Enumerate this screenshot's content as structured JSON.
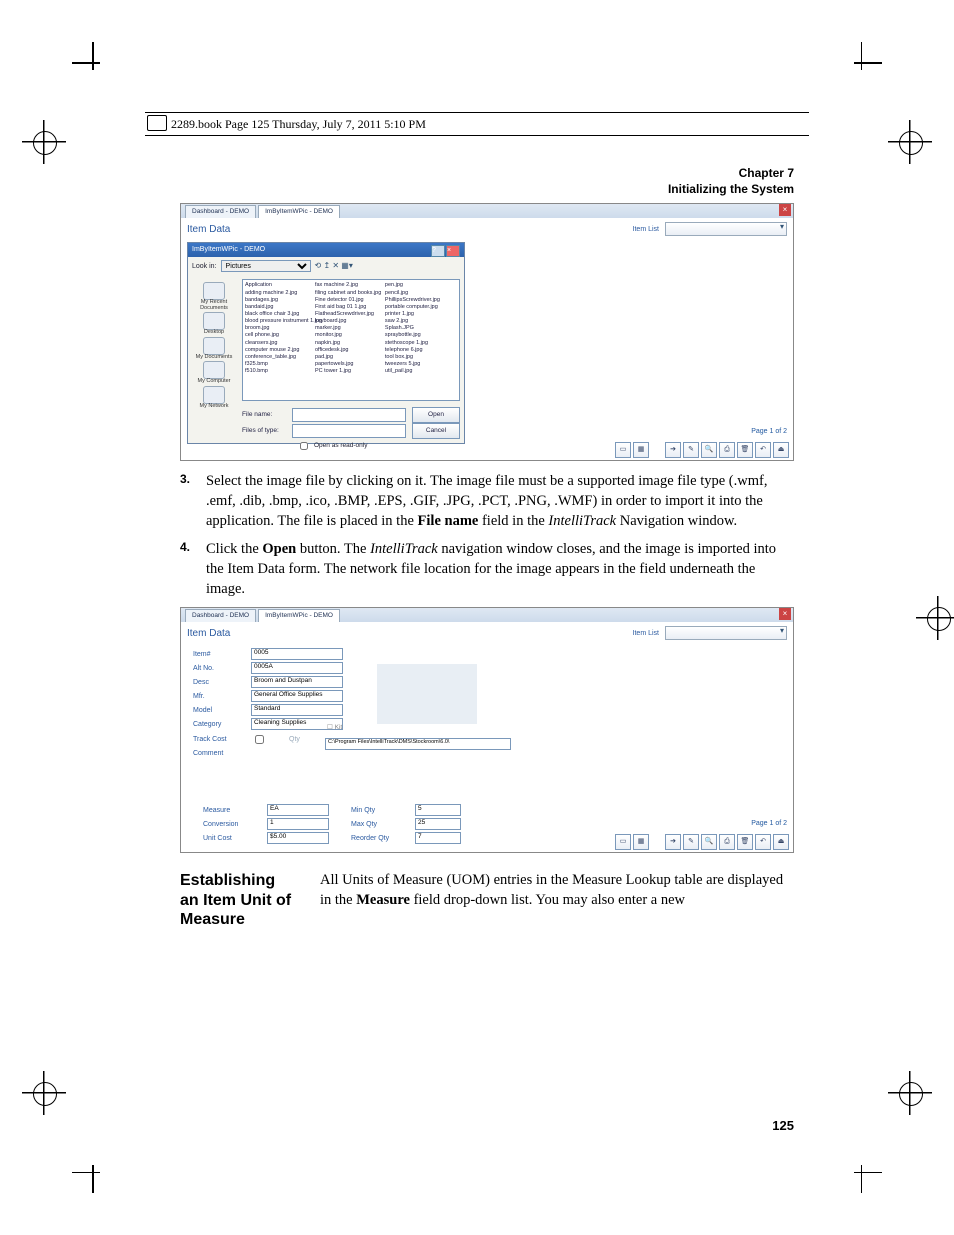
{
  "header_meta": "2289.book  Page 125  Thursday, July 7, 2011  5:10 PM",
  "chapter": {
    "line1": "Chapter 7",
    "line2": "Initializing the System"
  },
  "screenshot1": {
    "tabs": [
      "Dashboard - DEMO",
      "ImByItemWPic - DEMO"
    ],
    "form_title": "Item Data",
    "item_list_label": "Item List",
    "dialog_title": "ImByItemWPic - DEMO",
    "look_in_label": "Look in:",
    "look_in_value": "Pictures",
    "places": [
      "My Recent Documents",
      "Desktop",
      "My Documents",
      "My Computer",
      "My Network"
    ],
    "files_col1": [
      "Application",
      "adding machine 2.jpg",
      "bandages.jpg",
      "bandaid.jpg",
      "black office chair 3.jpg",
      "blood pressure instrument 1.jpg",
      "broom.jpg",
      "cell phone.jpg",
      "cleansers.jpg",
      "computer mouse 2.jpg",
      "conference_table.jpg",
      "f325.bmp",
      "f510.bmp"
    ],
    "files_col2": [
      "fax machine 2.jpg",
      "filing cabinet and books.jpg",
      "Fine detector 01.jpg",
      "First aid bag 01 1.jpg",
      "FlatheadScrewdriver.jpg",
      "keyboard.jpg",
      "marker.jpg",
      "monitor.jpg",
      "napkin.jpg",
      "officedesk.jpg",
      "pad.jpg",
      "papertowels.jpg",
      "PC tower 1.jpg"
    ],
    "files_col3": [
      "pen.jpg",
      "pencil.jpg",
      "PhillipsScrewdriver.jpg",
      "portable computer.jpg",
      "printer 1.jpg",
      "saw 2.jpg",
      "Splash.JPG",
      "spraybottle.jpg",
      "stethoscope 1.jpg",
      "telephone 6.jpg",
      "tool box.jpg",
      "tweezers 5.jpg",
      "util_pail.jpg"
    ],
    "file_name_label": "File name:",
    "file_type_label": "Files of type:",
    "open_label": "Open",
    "cancel_label": "Cancel",
    "readonly_label": "Open as read-only",
    "page_indicator": "Page 1 of 2"
  },
  "step3": {
    "num": "3.",
    "text_1": "Select the image file by clicking on it. The image file must be a supported image file type (.wmf, .emf, .dib, .bmp, .ico, .BMP, .EPS, .GIF, .JPG, .PCT, .PNG, .WMF) in order to import it into the application. The file is placed in the ",
    "bold_1": "File name",
    "text_2": " field in the ",
    "italic_1": "IntelliTrack",
    "text_3": " Navigation window."
  },
  "step4": {
    "num": "4.",
    "text_1": "Click the ",
    "bold_1": "Open",
    "text_2": " button. The ",
    "italic_1": "IntelliTrack",
    "text_3": " navigation window closes, and the image is imported into the Item Data form. The network file location for the image appears in the field underneath the image."
  },
  "screenshot2": {
    "tabs": [
      "Dashboard - DEMO",
      "ImByItemWPic - DEMO"
    ],
    "form_title": "Item Data",
    "item_list_label": "Item List",
    "labels": {
      "item_no": "Item#",
      "alt_no": "Alt No.",
      "desc": "Desc",
      "mfr": "Mfr.",
      "model": "Model",
      "category": "Category",
      "track_cost": "Track Cost",
      "qty": "Qty",
      "comment": "Comment",
      "kit": "Kit",
      "measure": "Measure",
      "conversion": "Conversion",
      "unit_cost": "Unit Cost",
      "min_qty": "Min Qty",
      "max_qty": "Max Qty",
      "reorder_qty": "Reorder Qty"
    },
    "values": {
      "item_no": "0005",
      "alt_no": "0005A",
      "desc": "Broom and Dustpan",
      "mfr": "General Office Supplies",
      "model": "Standard",
      "category": "Cleaning Supplies",
      "path": "C:\\Program Files\\IntelliTrack\\DMS\\Stockroom\\6.0\\",
      "measure": "EA",
      "conversion": "1",
      "unit_cost": "$5.00",
      "min_qty": "5",
      "max_qty": "25",
      "reorder_qty": "7"
    },
    "page_indicator": "Page 1 of 2"
  },
  "section": {
    "heading_l1": "Establishing",
    "heading_l2": "an Item Unit of",
    "heading_l3": "Measure",
    "body_1": "All Units of Measure (UOM) entries in the Measure Lookup table are displayed in the ",
    "bold_1": "Measure",
    "body_2": " field drop-down list. You may also enter a new"
  },
  "page_number": "125"
}
